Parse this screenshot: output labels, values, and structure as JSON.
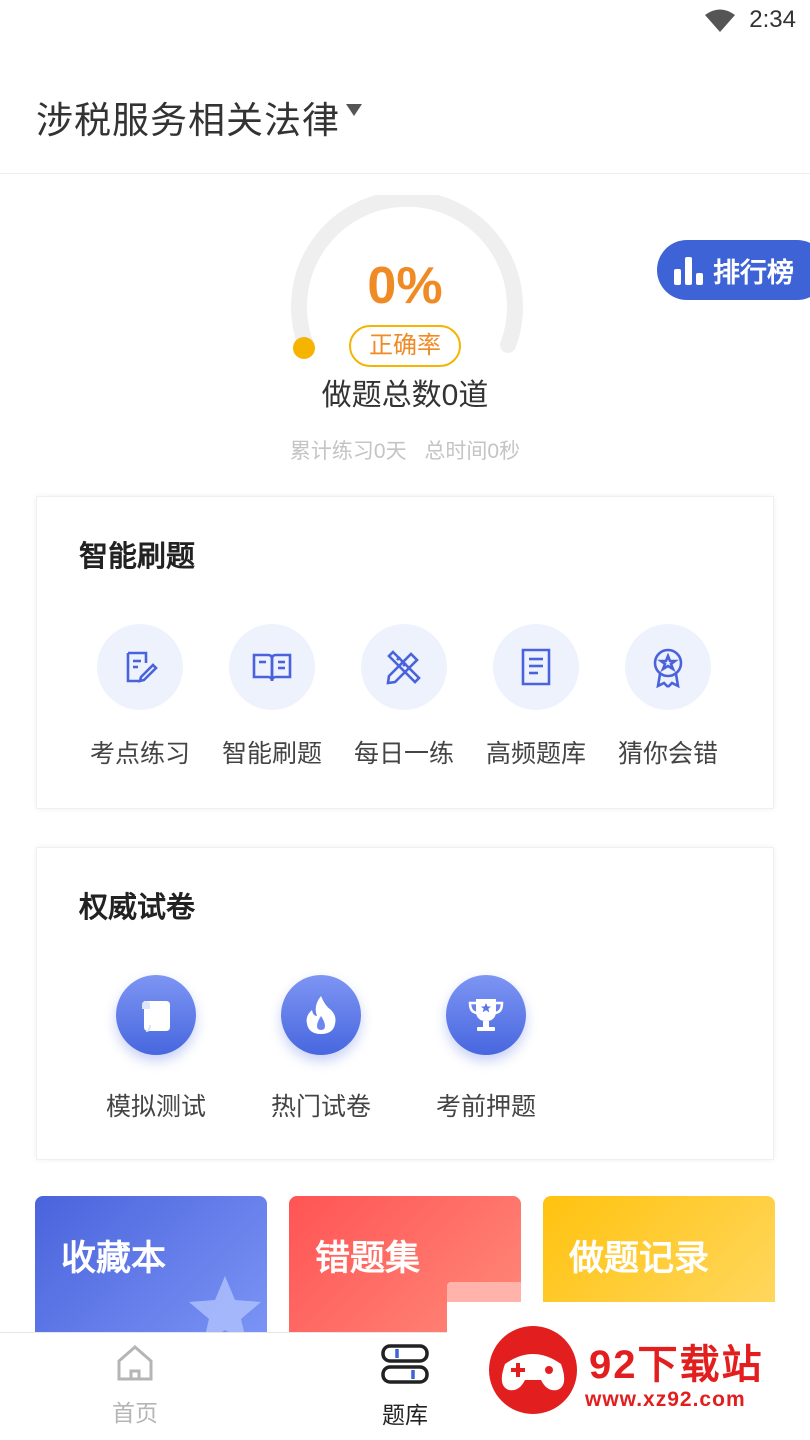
{
  "status_bar": {
    "time": "2:34"
  },
  "header": {
    "subject": "涉税服务相关法律"
  },
  "stats": {
    "accuracy_value": "0%",
    "accuracy_label": "正确率",
    "accuracy_fraction": 0,
    "total_questions": "做题总数0道",
    "practice_days": "累计练习0天",
    "total_time": "总时间0秒"
  },
  "rank_button": {
    "label": "排行榜"
  },
  "smart_practice": {
    "title": "智能刷题",
    "items": [
      {
        "label": "考点练习",
        "icon": "edit-doc-icon"
      },
      {
        "label": "智能刷题",
        "icon": "open-book-icon"
      },
      {
        "label": "每日一练",
        "icon": "pencil-ruler-icon"
      },
      {
        "label": "高频题库",
        "icon": "document-icon"
      },
      {
        "label": "猜你会错",
        "icon": "badge-icon"
      }
    ]
  },
  "papers": {
    "title": "权威试卷",
    "items": [
      {
        "label": "模拟测试",
        "icon": "scroll-icon"
      },
      {
        "label": "热门试卷",
        "icon": "fire-icon"
      },
      {
        "label": "考前押题",
        "icon": "trophy-icon"
      }
    ]
  },
  "tiles": [
    {
      "label": "收藏本",
      "color": "#4a63dc"
    },
    {
      "label": "错题集",
      "color": "#ff5454"
    },
    {
      "label": "做题记录",
      "color": "#ffc20e"
    }
  ],
  "nav": [
    {
      "label": "首页",
      "icon": "home-icon"
    },
    {
      "label": "题库",
      "icon": "question-bank-icon"
    }
  ],
  "watermark": {
    "text": "92下载站",
    "url": "www.xz92.com"
  }
}
